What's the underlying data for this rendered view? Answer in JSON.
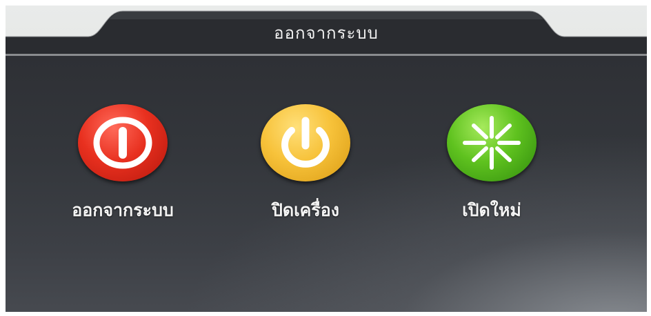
{
  "dialog": {
    "title": "ออกจากระบบ"
  },
  "options": [
    {
      "label": "ออกจากระบบ",
      "icon": "logout-icon",
      "color": "#e8301f"
    },
    {
      "label": "ปิดเครื่อง",
      "icon": "power-icon",
      "color": "#f7c23a"
    },
    {
      "label": "เปิดใหม่",
      "icon": "restart-icon",
      "color": "#5fc21f"
    }
  ]
}
